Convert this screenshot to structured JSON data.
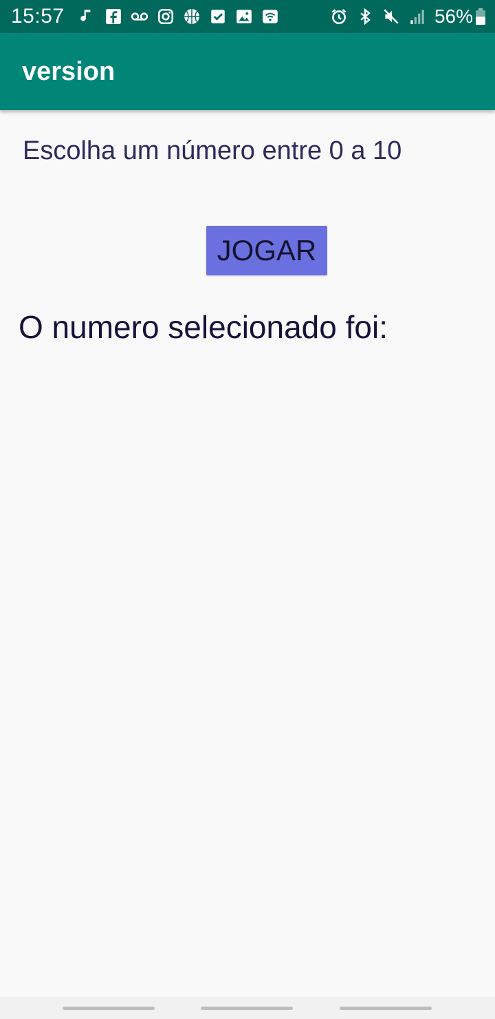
{
  "status_bar": {
    "time": "15:57",
    "notification_icons": [
      "music-note-icon",
      "facebook-icon",
      "voicemail-icon",
      "instagram-icon",
      "basketball-icon",
      "checkbox-icon",
      "image-icon",
      "wifi-hotspot-icon"
    ],
    "system_icons": [
      "alarm-icon",
      "bluetooth-icon",
      "mute-icon",
      "signal-icon"
    ],
    "battery_percent": "56%",
    "battery_level": 0.56
  },
  "app_bar": {
    "title": "version"
  },
  "main": {
    "prompt": "Escolha um número entre 0 a 10",
    "play_button_label": "JOGAR",
    "result_label": "O numero selecionado foi:"
  },
  "colors": {
    "status_bar": "#00695c",
    "app_bar": "#008577",
    "button": "#6b70e0",
    "prompt_text": "#2d2a5e",
    "result_text": "#16123a",
    "background": "#f9f9f9"
  }
}
